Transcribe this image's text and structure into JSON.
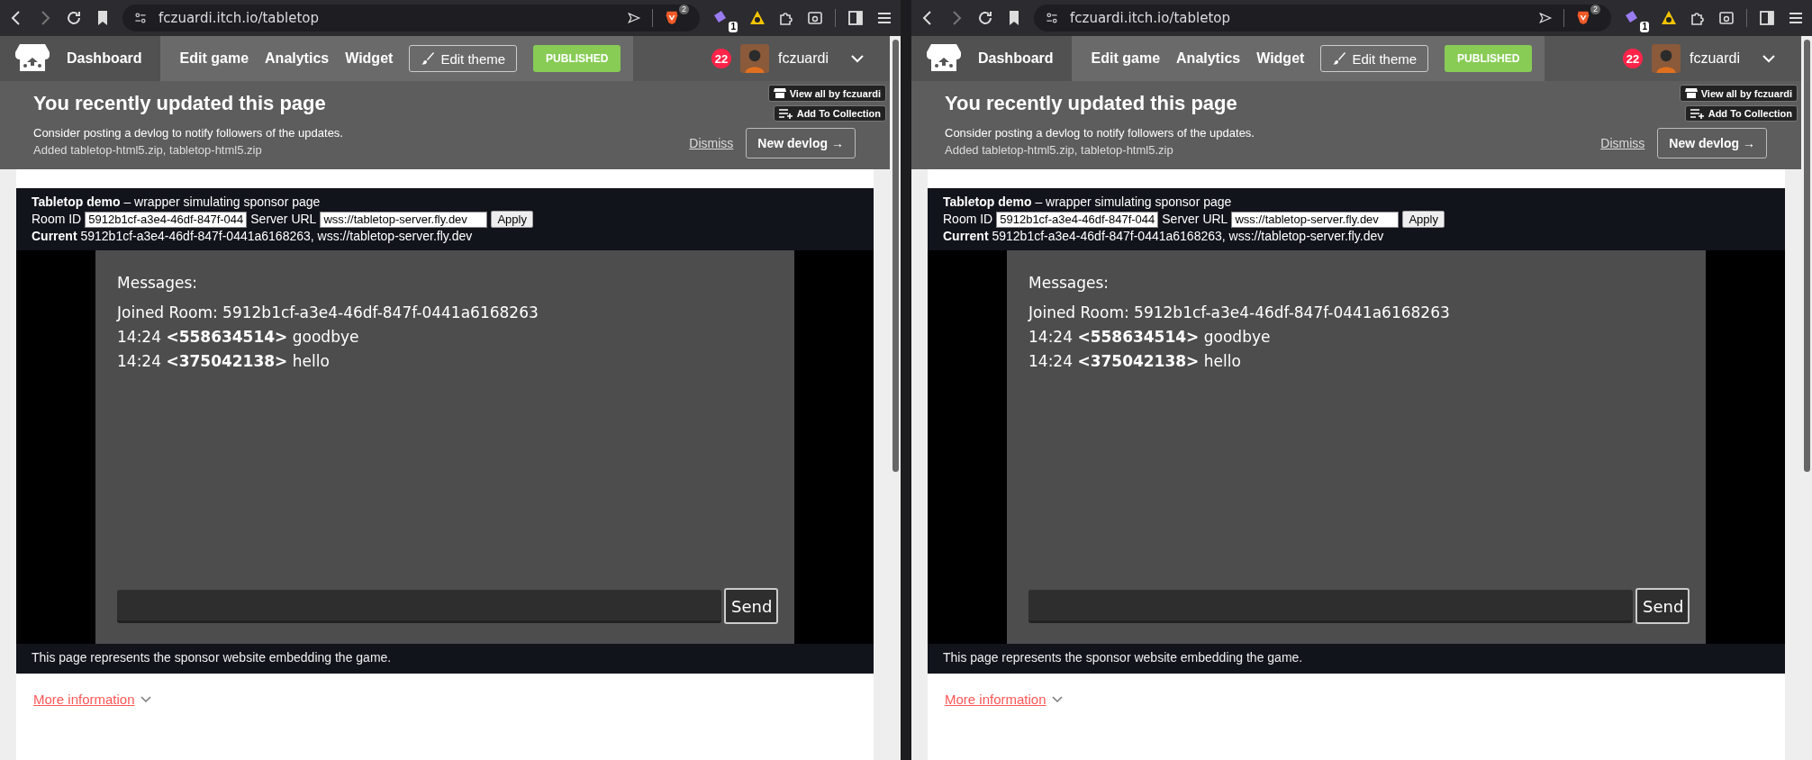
{
  "windows": [
    {
      "browser": {
        "url": "fczuardi.itch.io/tabletop",
        "shield_count": "2",
        "extension_badge": "1"
      },
      "nav": {
        "dashboard": "Dashboard",
        "links": [
          "Edit game",
          "Analytics",
          "Widget"
        ],
        "edit_theme": "Edit theme",
        "status": "PUBLISHED",
        "notifications": "22",
        "username": "fczuardi"
      },
      "overlay_buttons": [
        "View all by fczuardi",
        "Add To Collection"
      ],
      "banner": {
        "title": "You recently updated this page",
        "message": "Consider posting a devlog to notify followers of the updates.",
        "detail": "Added tabletop-html5.zip, tabletop-html5.zip",
        "dismiss": "Dismiss",
        "new_devlog": "New devlog →"
      },
      "demo": {
        "title": "**Tabletop demo** – wrapper simulating sponsor page",
        "room_label": "Room ID",
        "room_value": "5912b1cf-a3e4-46df-847f-044",
        "server_label": "Server URL",
        "server_value": "wss://tabletop-server.fly.dev",
        "apply": "Apply",
        "current": "**Current** 5912b1cf-a3e4-46df-847f-0441a6168263, wss://tabletop-server.fly.dev"
      },
      "game": {
        "heading": "Messages:",
        "lines": [
          "Joined Room: 5912b1cf-a3e4-46df-847f-0441a6168263",
          "14:24 **<558634514>** goodbye",
          "14:24 **<375042138>** hello"
        ],
        "send": "Send"
      },
      "footer": "This page represents the sponsor website embedding the game.",
      "more_info": "More information"
    },
    {
      "browser": {
        "url": "fczuardi.itch.io/tabletop",
        "shield_count": "2",
        "extension_badge": "1"
      },
      "nav": {
        "dashboard": "Dashboard",
        "links": [
          "Edit game",
          "Analytics",
          "Widget"
        ],
        "edit_theme": "Edit theme",
        "status": "PUBLISHED",
        "notifications": "22",
        "username": "fczuardi"
      },
      "overlay_buttons": [
        "View all by fczuardi",
        "Add To Collection"
      ],
      "banner": {
        "title": "You recently updated this page",
        "message": "Consider posting a devlog to notify followers of the updates.",
        "detail": "Added tabletop-html5.zip, tabletop-html5.zip",
        "dismiss": "Dismiss",
        "new_devlog": "New devlog →"
      },
      "demo": {
        "title": "**Tabletop demo** – wrapper simulating sponsor page",
        "room_label": "Room ID",
        "room_value": "5912b1cf-a3e4-46df-847f-044",
        "server_label": "Server URL",
        "server_value": "wss://tabletop-server.fly.dev",
        "apply": "Apply",
        "current": "**Current** 5912b1cf-a3e4-46df-847f-0441a6168263, wss://tabletop-server.fly.dev"
      },
      "game": {
        "heading": "Messages:",
        "lines": [
          "Joined Room: 5912b1cf-a3e4-46df-847f-0441a6168263",
          "14:24 **<558634514>** goodbye",
          "14:24 **<375042138>** hello"
        ],
        "send": "Send"
      },
      "footer": "This page represents the sponsor website embedding the game.",
      "more_info": "More information"
    }
  ]
}
